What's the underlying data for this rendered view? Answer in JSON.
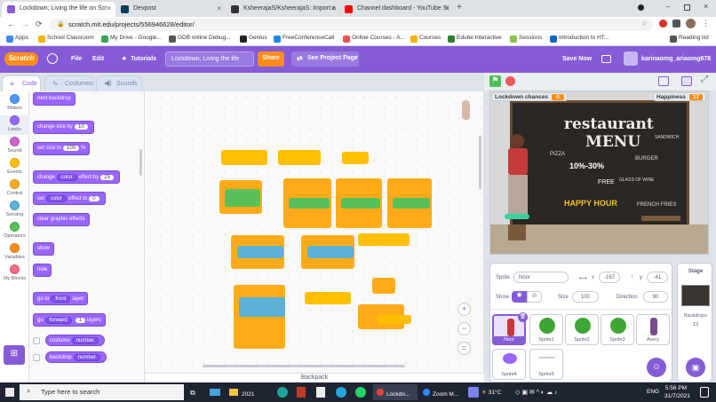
{
  "browser": {
    "tabs": [
      {
        "label": "Lockdown; Living the life on Scr",
        "color": "#855cd6",
        "active": true
      },
      {
        "label": "Devpost",
        "color": "#003e54",
        "active": false
      },
      {
        "label": "KsheerajaS/KsheerajaS: Import a",
        "color": "#333333",
        "active": false
      },
      {
        "label": "Channel dashboard - YouTube St",
        "color": "#ff0000",
        "active": false
      }
    ],
    "new_tab": "+",
    "url": "scratch.mit.edu/projects/556946628/editor/",
    "bookmarks": [
      {
        "label": "Apps",
        "color": "#4285f4"
      },
      {
        "label": "School Classroom",
        "color": "#f4b400"
      },
      {
        "label": "My Drive - Google...",
        "color": "#34a853"
      },
      {
        "label": "GDB online Debug...",
        "color": "#555555"
      },
      {
        "label": "Genius",
        "color": "#222222"
      },
      {
        "label": "FreeConferenceCall",
        "color": "#1e88e5"
      },
      {
        "label": "Online Courses - A...",
        "color": "#ec5252"
      },
      {
        "label": "Courses",
        "color": "#f4b400"
      },
      {
        "label": "Edube Interactive",
        "color": "#2e7d32"
      },
      {
        "label": "Sessions",
        "color": "#8bc34a"
      },
      {
        "label": "Introduction to HT...",
        "color": "#1565c0"
      },
      {
        "label": "Reading list",
        "color": "#555555"
      }
    ]
  },
  "menubar": {
    "logo": "Scratch",
    "file": "File",
    "edit": "Edit",
    "tutorials": "Tutorials",
    "project_title": "Lockdown; Living the life",
    "share": "Share",
    "see_project_page": "See Project Page",
    "save_now": "Save Now",
    "username": "karinaomg_ariaomg678"
  },
  "editor_tabs": {
    "code": "Code",
    "costumes": "Costumes",
    "sounds": "Sounds"
  },
  "categories": [
    {
      "label": "Motion",
      "color": "#4c97ff"
    },
    {
      "label": "Looks",
      "color": "#9966ff"
    },
    {
      "label": "Sound",
      "color": "#cf63cf"
    },
    {
      "label": "Events",
      "color": "#ffbf00"
    },
    {
      "label": "Control",
      "color": "#ffab19"
    },
    {
      "label": "Sensing",
      "color": "#5cb1d6"
    },
    {
      "label": "Operators",
      "color": "#59c059"
    },
    {
      "label": "Variables",
      "color": "#ff8c1a"
    },
    {
      "label": "My Blocks",
      "color": "#ff6680"
    }
  ],
  "palette": {
    "next_backdrop": "next backdrop",
    "change_size_by": "change size by",
    "change_size_val": "10",
    "set_size_to": "set size to",
    "set_size_val": "100",
    "set_size_unit": "%",
    "change_effect": "change",
    "effect_name": "color",
    "effect_by": "effect by",
    "effect_by_val": "25",
    "set_effect": "set",
    "effect_to": "effect to",
    "effect_to_val": "0",
    "clear_effects": "clear graphic effects",
    "show": "show",
    "hide": "hide",
    "go_to": "go to",
    "layer_front": "front",
    "layer": "layer",
    "go": "go",
    "forward": "forward",
    "layers_val": "1",
    "layers": "layers",
    "costume": "costume",
    "number": "number",
    "backdrop": "backdrop"
  },
  "backpack": "Backpack",
  "stage": {
    "monitors": [
      {
        "label": "Lockdown chances",
        "value": "0"
      },
      {
        "label": "Happiness",
        "value": "17"
      }
    ],
    "menu_title": "restaurant",
    "menu_sub": "MENU",
    "board_texts": [
      "PIZZA",
      "10%-30%",
      "HAPPY HOUR",
      "FRENCH FRIES",
      "BURGER",
      "GLASS OF WINE",
      "FREE",
      "SANDWICH"
    ]
  },
  "sprite_info": {
    "sprite_label": "Sprite",
    "sprite_name": "Noor",
    "x_label": "x",
    "x": "-167",
    "y_label": "y",
    "y": "-41",
    "show_label": "Show",
    "size_label": "Size",
    "size": "100",
    "direction_label": "Direction",
    "direction": "90"
  },
  "sprites": [
    {
      "name": "Noor",
      "selected": true
    },
    {
      "name": "Sprite1",
      "selected": false
    },
    {
      "name": "Sprite2",
      "selected": false
    },
    {
      "name": "Sprite3",
      "selected": false
    },
    {
      "name": "Avery",
      "selected": false
    },
    {
      "name": "Sprite4",
      "selected": false
    },
    {
      "name": "Sprite5",
      "selected": false
    }
  ],
  "stage_pane": {
    "title": "Stage",
    "backdrops_label": "Backdrops",
    "backdrops_count": "13"
  },
  "taskbar": {
    "search": "Type here to search",
    "folder": "2021",
    "chrome": "Lockdo...",
    "zoom": "Zoom M...",
    "weather": "31°C",
    "lang": "ENG",
    "time": "5:56 PM",
    "date": "31/7/2021"
  }
}
